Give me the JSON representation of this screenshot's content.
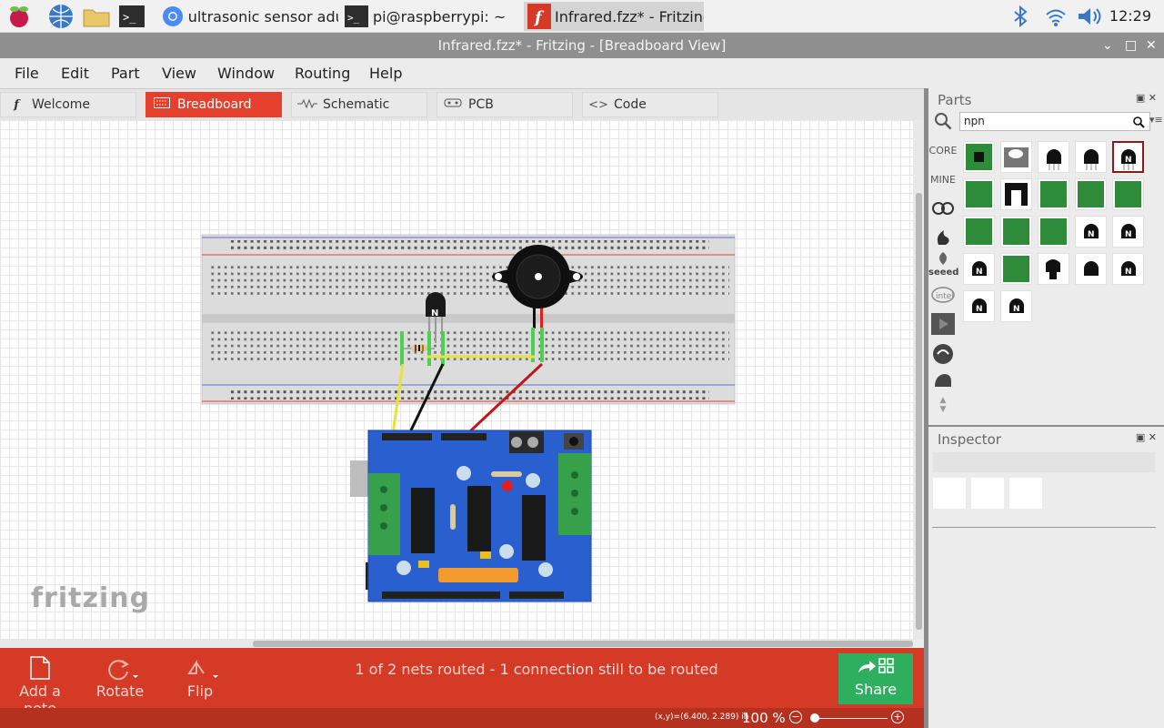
{
  "taskbar": {
    "tasks": [
      {
        "label": "ultrasonic sensor adu..."
      },
      {
        "label": "pi@raspberrypi: ~"
      },
      {
        "label": "Infrared.fzz* - Fritzing..."
      }
    ],
    "clock": "12:29"
  },
  "window": {
    "title": "Infrared.fzz* - Fritzing - [Breadboard View]"
  },
  "menu": {
    "items": [
      {
        "label": "File"
      },
      {
        "label": "Edit"
      },
      {
        "label": "Part"
      },
      {
        "label": "View"
      },
      {
        "label": "Window"
      },
      {
        "label": "Routing"
      },
      {
        "label": "Help"
      }
    ]
  },
  "tabs": [
    {
      "label": "Welcome"
    },
    {
      "label": "Breadboard",
      "active": true
    },
    {
      "label": "Schematic"
    },
    {
      "label": "PCB"
    },
    {
      "label": "Code"
    }
  ],
  "canvas": {
    "logo": "fritzing"
  },
  "toolbar": {
    "add_note": "Add a note",
    "rotate": "Rotate",
    "flip": "Flip",
    "routing_status": "1 of 2 nets routed - 1 connection still to be routed",
    "share": "Share"
  },
  "status": {
    "coords": "(x,y)=(6.400, 2.289) in",
    "zoom": "100 %"
  },
  "parts": {
    "title": "Parts",
    "search_value": "npn",
    "bins": [
      "CORE",
      "MINE",
      "seeed"
    ]
  },
  "inspector": {
    "title": "Inspector"
  },
  "colors": {
    "accent": "#d43a26",
    "share": "#2eae5f",
    "tab_active": "#e5402d"
  }
}
